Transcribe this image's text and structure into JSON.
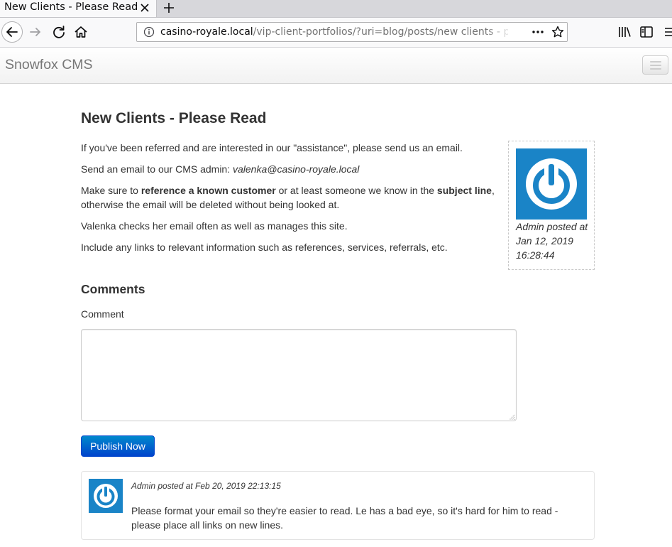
{
  "browser": {
    "tab_title": "New Clients - Please Read",
    "url_host": "casino-royale.local",
    "url_path": "/vip-client-portfolios/?uri=blog/posts/new clients - please read"
  },
  "site": {
    "brand": "Snowfox CMS"
  },
  "post": {
    "title": "New Clients - Please Read",
    "p1": "If you've been referred and are interested in our \"assistance\", please send us an email.",
    "p2_prefix": "Send an email to our CMS admin: ",
    "p2_email": "valenka@casino-royale.local",
    "p3_a": "Make sure to ",
    "p3_b": "reference a known customer",
    "p3_c": " or at least someone we know in the ",
    "p3_d": "subject line",
    "p3_e": ", otherwise the email will be deleted without being looked at.",
    "p4": "Valenka checks her email often as well as manages this site.",
    "p5": "Include any links to relevant information such as references, services, referrals, etc.",
    "author_caption": "Admin posted at Jan 12, 2019 16:28:44"
  },
  "comments": {
    "heading": "Comments",
    "field_label": "Comment",
    "textarea_value": "",
    "publish_label": "Publish Now",
    "items": [
      {
        "meta": "Admin posted at Feb 20, 2019 22:13:15",
        "body": "Please format your email so they're easier to read. Le has a bad eye, so it's hard for him to read - please place all links on new lines."
      }
    ]
  },
  "colors": {
    "avatar_blue": "#1a84c7",
    "button_blue": "#0062cc"
  },
  "icons": [
    "info-icon",
    "back-arrow-icon",
    "forward-arrow-icon",
    "reload-icon",
    "home-icon",
    "page-actions-icon",
    "bookmark-star-icon",
    "library-icon",
    "sidebar-icon",
    "overflow-menu-icon",
    "close-icon",
    "plus-icon",
    "power-icon",
    "hamburger-icon"
  ]
}
